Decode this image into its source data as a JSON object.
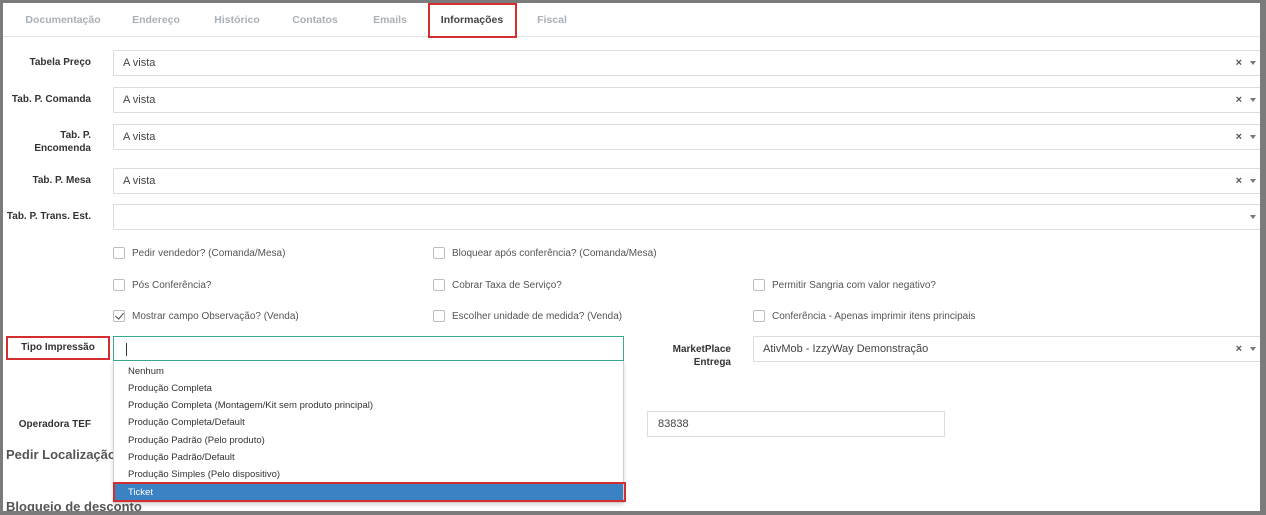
{
  "tabs": [
    {
      "label": "Documentação"
    },
    {
      "label": "Endereço"
    },
    {
      "label": "Histórico"
    },
    {
      "label": "Contatos"
    },
    {
      "label": "Emails"
    },
    {
      "label": "Informações"
    },
    {
      "label": "Fiscal"
    }
  ],
  "active_tab": "Informações",
  "fields": {
    "tabela_preco": {
      "label": "Tabela Preço",
      "value": "A vista"
    },
    "tab_comanda": {
      "label": "Tab. P. Comanda",
      "value": "A vista"
    },
    "tab_encomenda": {
      "label_line1": "Tab. P.",
      "label_line2": "Encomenda",
      "value": "A vista"
    },
    "tab_mesa": {
      "label": "Tab. P. Mesa",
      "value": "A vista"
    },
    "tab_trans": {
      "label": "Tab. P. Trans. Est.",
      "value": ""
    },
    "clear_icon": "×"
  },
  "checkboxes": [
    {
      "label": "Pedir vendedor? (Comanda/Mesa)",
      "checked": false
    },
    {
      "label": "Bloquear após conferência? (Comanda/Mesa)",
      "checked": false
    },
    {
      "label": "Pós Conferência?",
      "checked": false
    },
    {
      "label": "Cobrar Taxa de Serviço?",
      "checked": false
    },
    {
      "label": "Permitir Sangria com valor negativo?",
      "checked": false
    },
    {
      "label": "Mostrar campo Observação? (Venda)",
      "checked": true
    },
    {
      "label": "Escolher unidade de medida? (Venda)",
      "checked": false
    },
    {
      "label": "Conferência - Apenas imprimir itens principais",
      "checked": false
    }
  ],
  "tipo_impressao": {
    "label": "Tipo Impressão",
    "value": "",
    "options": [
      "Nenhum",
      "Produção Completa",
      "Produção Completa (Montagem/Kit sem produto principal)",
      "Produção Completa/Default",
      "Produção Padrão (Pelo produto)",
      "Produção Padrão/Default",
      "Produção Simples (Pelo dispositivo)",
      "Ticket"
    ],
    "highlighted": "Ticket"
  },
  "marketplace": {
    "label_line1": "MarketPlace",
    "label_line2": "Entrega",
    "value": "AtivMob - IzzyWay Demonstração"
  },
  "operadora_tef": {
    "label": "Operadora TEF",
    "value": "83838"
  },
  "section_pedir_localizacao": "Pedir Localização (",
  "section_bloqueio": "Bloqueio de desconto",
  "colors": {
    "highlight_red": "#d32f2f",
    "selected_option": "#3b82c4",
    "focus_border": "#37a98e"
  }
}
